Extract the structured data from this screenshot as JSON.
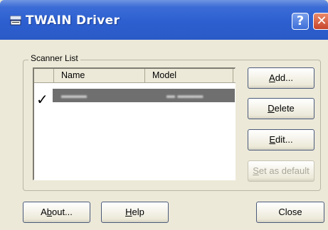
{
  "window": {
    "title": "TWAIN Driver",
    "help_button": "?",
    "close_button": "✕"
  },
  "scanner_list": {
    "label": "Scanner List",
    "columns": [
      "Name",
      "Model"
    ],
    "rows": [
      {
        "checked": true,
        "check_glyph": "✓",
        "name": "▬▬▬",
        "model": "▬ ▬▬▬"
      }
    ]
  },
  "side_buttons": {
    "add": {
      "mnemonic": "A",
      "rest": "dd..."
    },
    "delete": {
      "mnemonic": "D",
      "rest": "elete"
    },
    "edit": {
      "mnemonic": "E",
      "rest": "dit..."
    },
    "set_default": {
      "mnemonic": "S",
      "rest": "et as default"
    }
  },
  "bottom_buttons": {
    "about": {
      "pre": "A",
      "mnemonic": "b",
      "rest": "out..."
    },
    "help": {
      "mnemonic": "H",
      "rest": "elp"
    },
    "close": {
      "label": "Close"
    }
  },
  "colors": {
    "titlebar": "#2d5fd0",
    "dialog_bg": "#ece9d8",
    "selected_row": "#6f6f6f"
  }
}
